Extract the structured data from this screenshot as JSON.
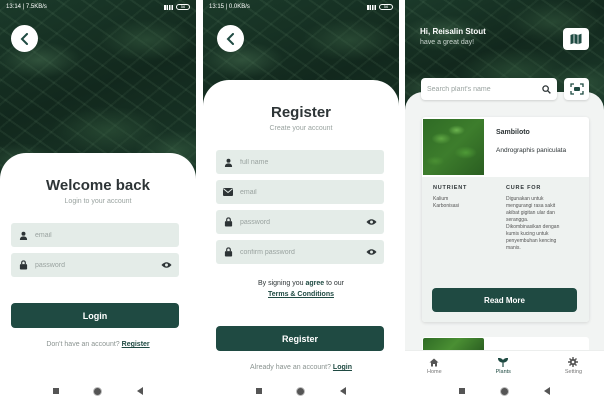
{
  "screens": {
    "login": {
      "status_time": "13:14 | 7.5KB/s",
      "battery": "56",
      "title": "Welcome back",
      "subtitle": "Login to your account",
      "email_placeholder": "email",
      "password_placeholder": "password",
      "login_button": "Login",
      "footer_text": "Don't have an account?",
      "footer_link": "Register"
    },
    "register": {
      "status_time": "13:15 | 0.0KB/s",
      "battery": "56",
      "title": "Register",
      "subtitle": "Create your account",
      "fullname_placeholder": "full name",
      "email_placeholder": "email",
      "password_placeholder": "password",
      "confirm_placeholder": "confirm password",
      "terms_prefix": "By signing you",
      "terms_agree": "agree",
      "terms_to": "to our",
      "terms_link": "Terms & Conditions",
      "register_button": "Register",
      "footer_text": "Already have an account?",
      "footer_link": "Login"
    },
    "home": {
      "greeting": "Hi, Reisalin Stout",
      "greeting_sub": "have a great day!",
      "search_placeholder": "Search plant's name",
      "plant": {
        "name": "Sambiloto",
        "scientific": "Andrographis paniculata",
        "nutrient_title": "NUTRIENT",
        "nutrients": [
          "Kalium",
          "Karbonisasi"
        ],
        "cure_title": "CURE FOR",
        "cure_lines": [
          "Digunakan untuk",
          "mengurangi rasa sakit",
          "akibat gigitan ular dan",
          "serangga.",
          "Dikombinasikan dengan",
          "kumis kucing untuk",
          "penyembuhan kencing",
          "manis."
        ],
        "read_more": "Read More"
      },
      "tabs": [
        {
          "label": "Home",
          "icon": "home-icon"
        },
        {
          "label": "Plants",
          "icon": "plant-icon"
        },
        {
          "label": "Setting",
          "icon": "gear-icon"
        }
      ]
    }
  },
  "colors": {
    "primary": "#1f4a42",
    "field_bg": "#e4ece8",
    "leaf_dark": "#12281d"
  }
}
